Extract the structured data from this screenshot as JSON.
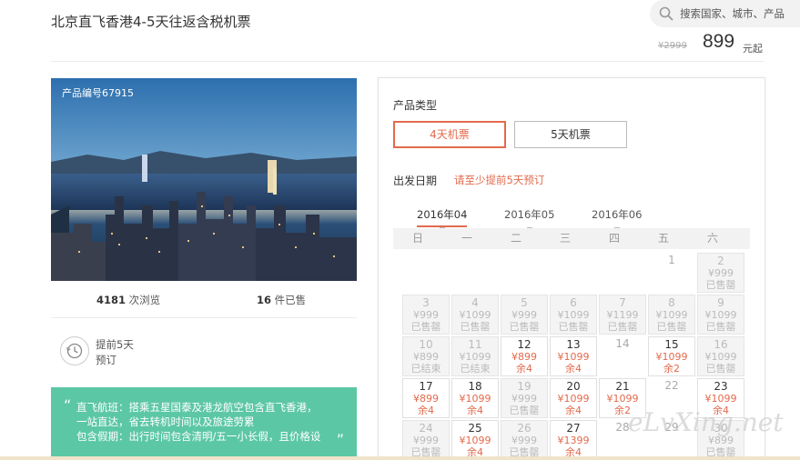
{
  "title": "北京直飞香港4-5天往返含税机票",
  "search": {
    "placeholder": "搜索国家、城市、产品"
  },
  "price": {
    "old": "¥2999",
    "new": "899",
    "unit": "元起"
  },
  "image": {
    "code": "产品编号67915"
  },
  "stats": {
    "views_num": "4181",
    "views_label": "次浏览",
    "sold_num": "16",
    "sold_label": "件已售"
  },
  "advance": {
    "line1": "提前5天",
    "line2": "预订"
  },
  "promo": {
    "lines": [
      "直飞航班：搭乘五星国泰及港龙航空包含直飞香港，",
      "一站直达，省去转机时间以及旅途劳累",
      "包含假期：出行时间包含清明/五一小长假，且价格设"
    ]
  },
  "product_type": {
    "label": "产品类型",
    "options": [
      "4天机票",
      "5天机票"
    ],
    "selected": "4天机票"
  },
  "departure": {
    "label": "出发日期",
    "note": "请至少提前5天预订"
  },
  "months": [
    "2016年04",
    "2016年05",
    "2016年06"
  ],
  "selected_month": "2016年04",
  "weekdays": [
    "日",
    "一",
    "二",
    "三",
    "四",
    "五",
    "六"
  ],
  "calendar": [
    {
      "d": "1",
      "p": "",
      "s": "",
      "t": "plain"
    },
    {
      "d": "2",
      "p": "¥999",
      "s": "已售罄",
      "t": "disabled"
    },
    {
      "d": "3",
      "p": "¥999",
      "s": "已售罄",
      "t": "disabled"
    },
    {
      "d": "4",
      "p": "¥1099",
      "s": "已售罄",
      "t": "disabled"
    },
    {
      "d": "5",
      "p": "¥999",
      "s": "已售罄",
      "t": "disabled"
    },
    {
      "d": "6",
      "p": "¥1099",
      "s": "已售罄",
      "t": "disabled"
    },
    {
      "d": "7",
      "p": "¥1199",
      "s": "已售罄",
      "t": "disabled"
    },
    {
      "d": "8",
      "p": "¥1099",
      "s": "已售罄",
      "t": "disabled"
    },
    {
      "d": "9",
      "p": "¥1099",
      "s": "已售罄",
      "t": "disabled"
    },
    {
      "d": "10",
      "p": "¥899",
      "s": "已结束",
      "t": "disabled"
    },
    {
      "d": "11",
      "p": "¥1099",
      "s": "已结束",
      "t": "disabled"
    },
    {
      "d": "12",
      "p": "¥899",
      "s": "余4",
      "t": "avail"
    },
    {
      "d": "13",
      "p": "¥1099",
      "s": "余4",
      "t": "avail"
    },
    {
      "d": "14",
      "p": "",
      "s": "",
      "t": "plain"
    },
    {
      "d": "15",
      "p": "¥1099",
      "s": "余2",
      "t": "avail"
    },
    {
      "d": "16",
      "p": "¥1099",
      "s": "已售罄",
      "t": "disabled"
    },
    {
      "d": "17",
      "p": "¥899",
      "s": "余4",
      "t": "avail"
    },
    {
      "d": "18",
      "p": "¥1099",
      "s": "余4",
      "t": "avail"
    },
    {
      "d": "19",
      "p": "¥999",
      "s": "已售罄",
      "t": "disabled"
    },
    {
      "d": "20",
      "p": "¥1099",
      "s": "余4",
      "t": "avail"
    },
    {
      "d": "21",
      "p": "¥1099",
      "s": "余2",
      "t": "avail"
    },
    {
      "d": "22",
      "p": "",
      "s": "",
      "t": "plain"
    },
    {
      "d": "23",
      "p": "¥1099",
      "s": "余4",
      "t": "avail"
    },
    {
      "d": "24",
      "p": "¥999",
      "s": "已售罄",
      "t": "disabled"
    },
    {
      "d": "25",
      "p": "¥1099",
      "s": "余4",
      "t": "avail"
    },
    {
      "d": "26",
      "p": "¥999",
      "s": "已售罄",
      "t": "disabled"
    },
    {
      "d": "27",
      "p": "¥1399",
      "s": "余4",
      "t": "avail"
    },
    {
      "d": "28",
      "p": "",
      "s": "",
      "t": "plain"
    },
    {
      "d": "29",
      "p": "",
      "s": "",
      "t": "plain"
    },
    {
      "d": "30",
      "p": "¥899",
      "s": "已售罄",
      "t": "disabled"
    }
  ],
  "calendar_start_col": 5,
  "watermark": "eLvXing.net",
  "colors": {
    "accent": "#e26a4d",
    "promo": "#5cc7a5"
  }
}
